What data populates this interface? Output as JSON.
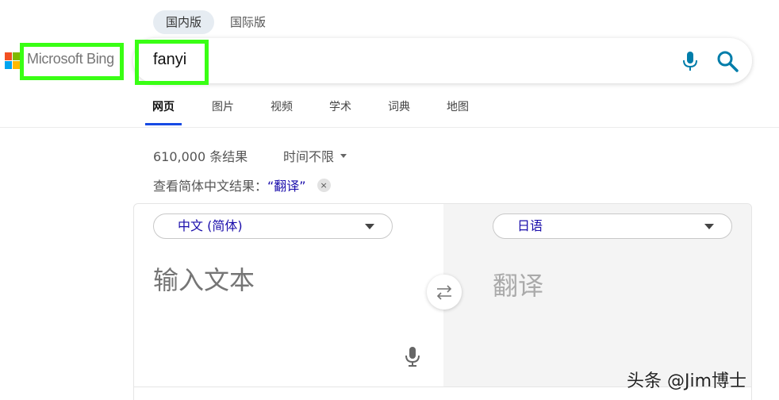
{
  "region_tabs": [
    "国内版",
    "国际版"
  ],
  "logo": {
    "text": "Microsoft Bing"
  },
  "search": {
    "query": "fanyi"
  },
  "nav_tabs": [
    "网页",
    "图片",
    "视频",
    "学术",
    "词典",
    "地图"
  ],
  "results": {
    "count": "610,000 条结果",
    "time_filter": "时间不限",
    "cn_prefix": "查看简体中文结果：",
    "cn_link": "“翻译”",
    "close": "×"
  },
  "translator": {
    "source_lang": "中文 (简体)",
    "target_lang": "日语",
    "source_placeholder": "输入文本",
    "target_text": "翻译"
  },
  "watermark": "头条 @Jim博士",
  "colors": {
    "highlight": "#39ff14",
    "accent_blue": "#174ae4",
    "link": "#1a0dab",
    "icon_teal": "#007daa"
  }
}
